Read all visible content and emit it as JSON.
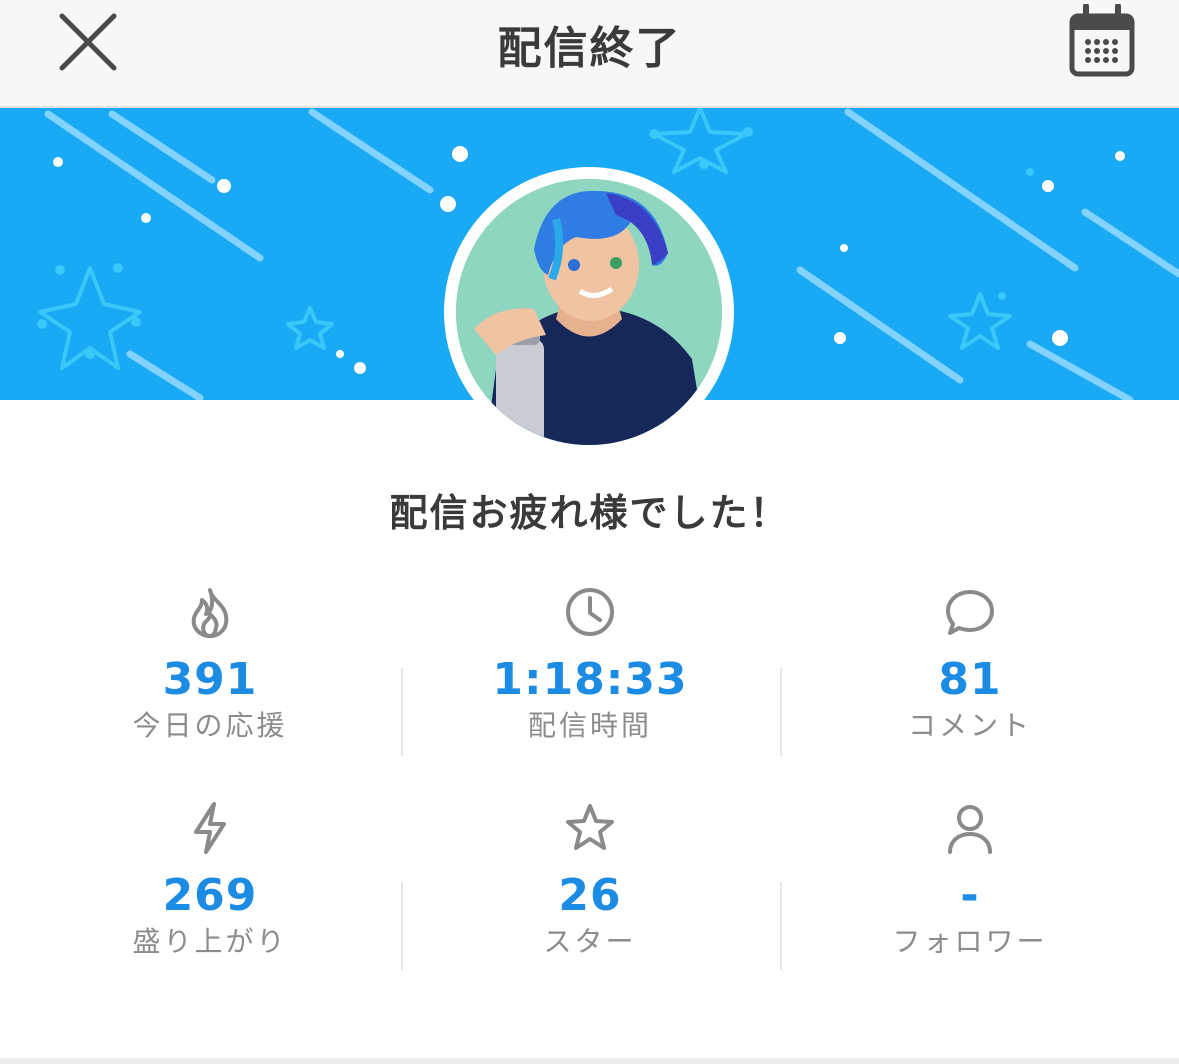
{
  "header": {
    "title": "配信終了",
    "close_icon": "close-icon",
    "calendar_icon": "calendar-icon"
  },
  "banner": {
    "color": "#1aa9f5"
  },
  "greeting": "配信お疲れ様でした！",
  "stats": [
    {
      "icon": "flame-icon",
      "value": "391",
      "label": "今日の応援"
    },
    {
      "icon": "clock-icon",
      "value": "1:18:33",
      "label": "配信時間"
    },
    {
      "icon": "comment-icon",
      "value": "81",
      "label": "コメント"
    },
    {
      "icon": "lightning-icon",
      "value": "269",
      "label": "盛り上がり"
    },
    {
      "icon": "star-icon",
      "value": "26",
      "label": "スター"
    },
    {
      "icon": "person-icon",
      "value": "-",
      "label": "フォロワー"
    }
  ],
  "colors": {
    "accent": "#1b8be4",
    "label": "#8c8c8c",
    "title": "#3a3a3a"
  }
}
